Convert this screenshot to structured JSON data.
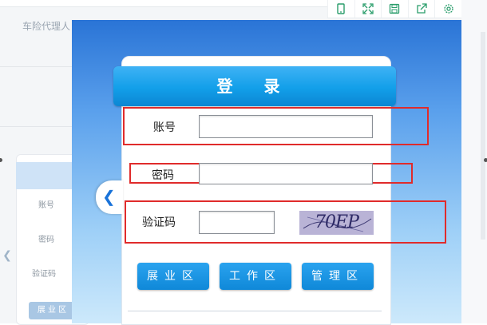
{
  "background": {
    "header_text": "车险代理人",
    "labels": [
      "账号",
      "密码",
      "验证码"
    ],
    "button": "展 业 区"
  },
  "toolbar": {
    "icons": [
      "tablet-icon",
      "fullscreen-icon",
      "save-icon",
      "share-icon",
      "settings-icon"
    ]
  },
  "login": {
    "title": "登 录",
    "account_label": "账号",
    "password_label": "密码",
    "captcha_label": "验证码",
    "account_value": "",
    "password_value": "",
    "captcha_value": "",
    "captcha_text": "70EP",
    "buttons": {
      "zone1": "展业区",
      "zone2": "工作区",
      "zone3": "管理区"
    }
  },
  "colors": {
    "highlight": "#e02b2b",
    "title_bar": "#129fe9",
    "button": "#0f88d8"
  }
}
